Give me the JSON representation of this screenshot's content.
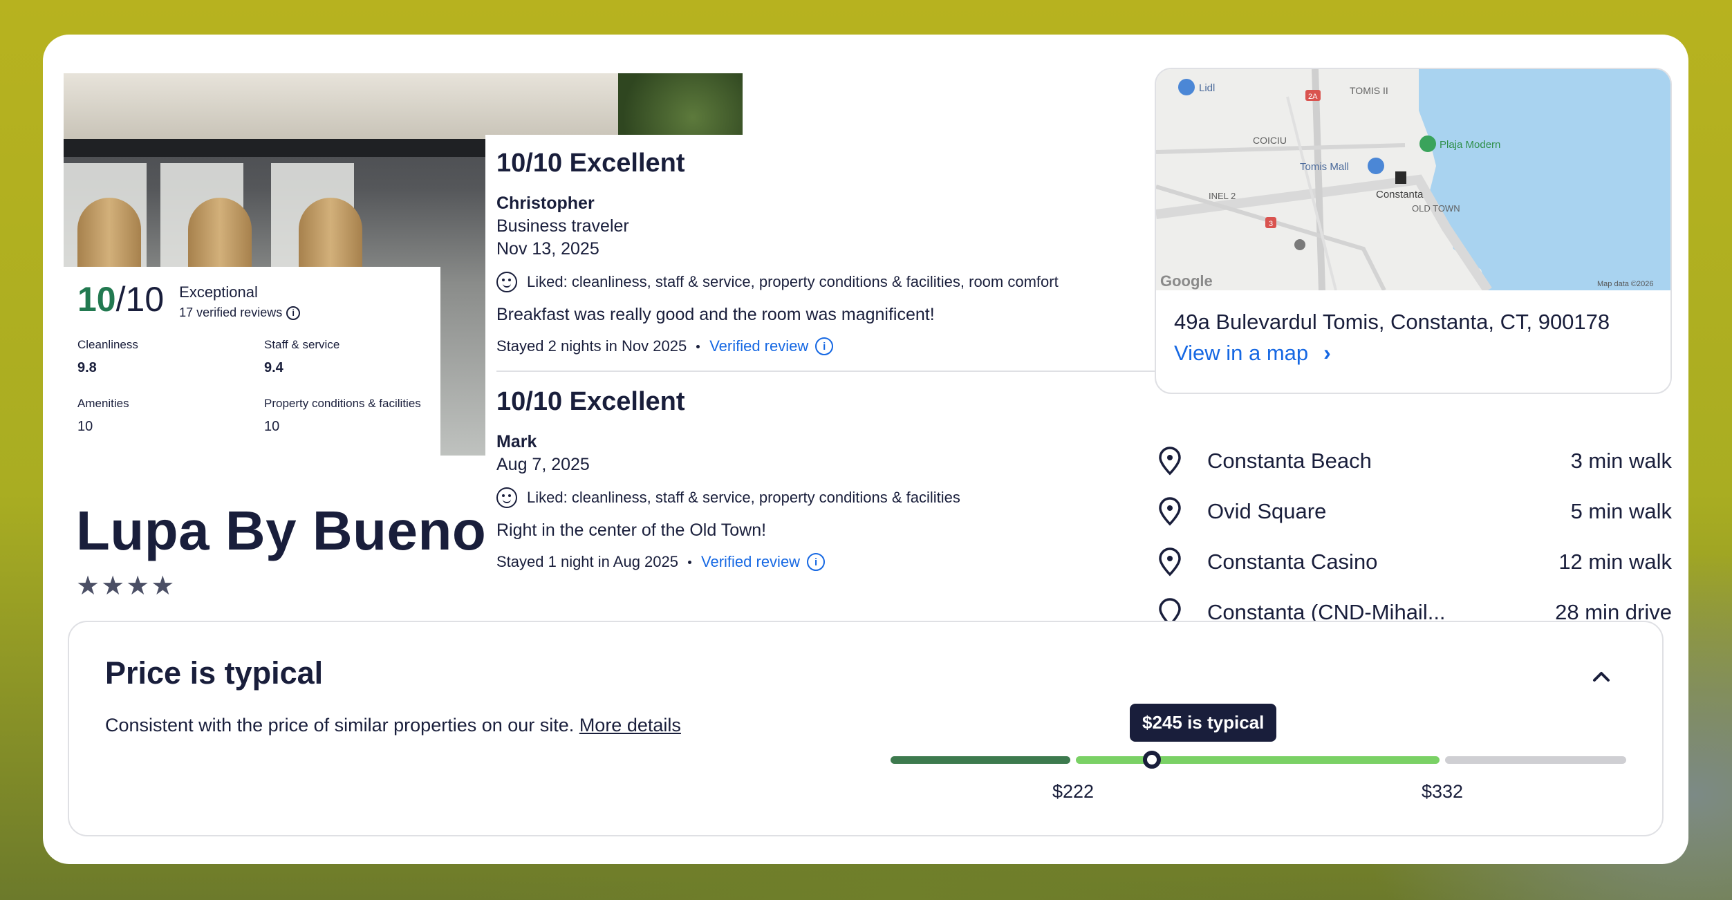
{
  "hotel": {
    "name": "Lupa By Bueno",
    "stars": "★★★★"
  },
  "rating": {
    "score": "10",
    "out_of": "/10",
    "label": "Exceptional",
    "verified_reviews": "17 verified reviews",
    "subscores": [
      {
        "name": "Cleanliness",
        "value": "9.8"
      },
      {
        "name": "Staff & service",
        "value": "9.4"
      },
      {
        "name": "Amenities",
        "value": "10"
      },
      {
        "name": "Property conditions & facilities",
        "value": "10"
      }
    ]
  },
  "reviews": [
    {
      "title": "10/10 Excellent",
      "name": "Christopher",
      "traveler_type": "Business traveler",
      "date": "Nov 13, 2025",
      "liked": "Liked: cleanliness, staff & service, property conditions & facilities, room comfort",
      "text": "Breakfast was really good and the room was magnificent!",
      "stay": "Stayed 2 nights in Nov 2025",
      "verified": "Verified review"
    },
    {
      "title": "10/10 Excellent",
      "name": "Mark",
      "date": "Aug 7, 2025",
      "liked": "Liked: cleanliness, staff & service, property conditions & facilities",
      "text": "Right in the center of the Old Town!",
      "stay": "Stayed 1 night in Aug 2025",
      "verified": "Verified review"
    }
  ],
  "map": {
    "labels": {
      "lidl": "Lidl",
      "tomis_ii": "TOMIS II",
      "coiciu": "COICIU",
      "tomis_mall": "Tomis Mall",
      "plaja": "Plaja Modern",
      "inel": "INEL 2",
      "constanta": "Constanta",
      "old_town": "OLD TOWN",
      "google": "Google",
      "map_data": "Map data ©2026",
      "road_2a": "2A",
      "road_3": "3"
    },
    "address": "49a Bulevardul Tomis, Constanta, CT, 900178",
    "view_link": "View in a map"
  },
  "pois": [
    {
      "name": "Constanta Beach",
      "distance": "3 min walk"
    },
    {
      "name": "Ovid Square",
      "distance": "5 min walk"
    },
    {
      "name": "Constanta Casino",
      "distance": "12 min walk"
    },
    {
      "name": "Constanta (CND-Mihail...",
      "distance": "28 min drive"
    }
  ],
  "price": {
    "title": "Price is typical",
    "description": "Consistent with the price of similar properties on our site.",
    "more_details": "More details",
    "tooltip": "$245 is typical",
    "low_label": "$222",
    "high_label": "$332",
    "current": 245,
    "colors": {
      "low": "#3d7a4e",
      "typical": "#7ad165",
      "high": "#cfcfd3"
    }
  },
  "icons": {
    "info": "i",
    "chevron_right": "›",
    "chevron_up": "chevron-up-icon",
    "pin": "map-pin-icon",
    "smile": "smile-icon"
  }
}
